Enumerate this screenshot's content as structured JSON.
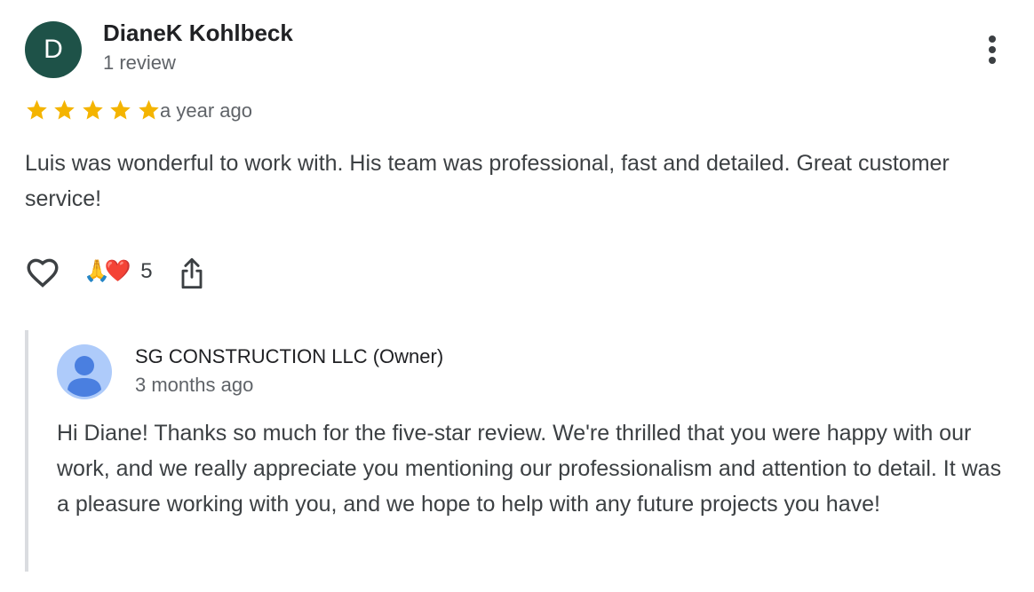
{
  "review": {
    "avatar_initial": "D",
    "reviewer_name": "DianeK Kohlbeck",
    "review_count": "1 review",
    "rating": 5,
    "timestamp": "a year ago",
    "text": "Luis was wonderful to work with. His team was professional, fast and detailed. Great customer service!",
    "reactions": {
      "emojis": "🙏❤️",
      "count": "5"
    },
    "icons": {
      "more": "more-vert-icon",
      "star": "star-icon",
      "like": "heart-outline-icon",
      "share": "share-icon"
    }
  },
  "reply": {
    "owner_name": "SG CONSTRUCTION LLC (Owner)",
    "timestamp": "3 months ago",
    "text": "Hi Diane! Thanks so much for the five-star review. We're thrilled that you were happy with our work, and we really appreciate you mentioning our professionalism and attention to detail. It was a pleasure working with you, and we hope to help with any future projects you have!",
    "avatar_icon": "default-profile-icon"
  },
  "colors": {
    "avatar_bg": "#1e5248",
    "star": "#f4b400",
    "owner_avatar_bg": "#aecbfa",
    "owner_avatar_fg": "#4a7fe0",
    "reply_bar": "#dadce0"
  }
}
